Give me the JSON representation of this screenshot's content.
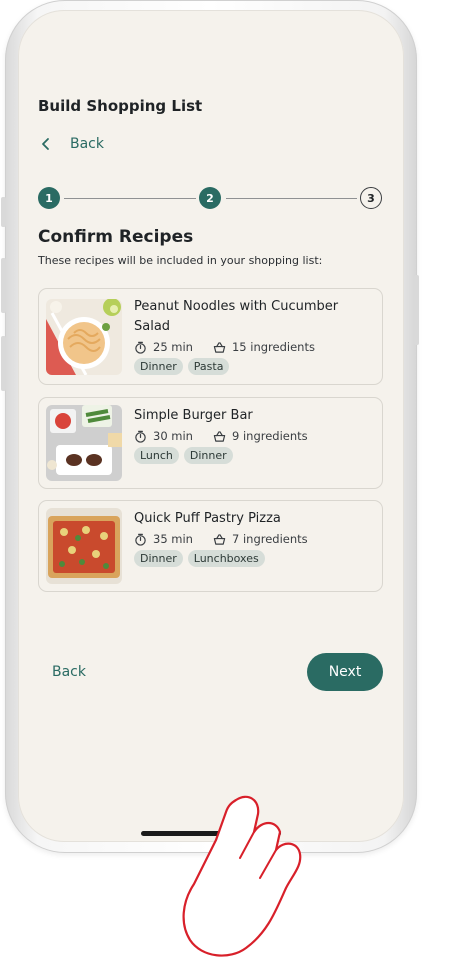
{
  "app": {
    "title": "Build Shopping List",
    "back_label": "Back"
  },
  "stepper": {
    "steps": [
      {
        "label": "1",
        "state": "done"
      },
      {
        "label": "2",
        "state": "done"
      },
      {
        "label": "3",
        "state": "todo"
      }
    ]
  },
  "section": {
    "title": "Confirm Recipes",
    "subtitle": "These recipes will be included in your shopping list:"
  },
  "recipes": [
    {
      "name": "Peanut Noodles with Cucumber Salad",
      "time": "25 min",
      "ingredients": "15 ingredients",
      "tags": [
        "Dinner",
        "Pasta"
      ]
    },
    {
      "name": "Simple Burger Bar",
      "time": "30 min",
      "ingredients": "9 ingredients",
      "tags": [
        "Lunch",
        "Dinner"
      ]
    },
    {
      "name": "Quick Puff Pastry Pizza",
      "time": "35 min",
      "ingredients": "7 ingredients",
      "tags": [
        "Dinner",
        "Lunchboxes"
      ]
    }
  ],
  "footer": {
    "back_label": "Back",
    "next_label": "Next"
  },
  "colors": {
    "accent": "#2a6b63",
    "background": "#f5f2ec",
    "tag_bg": "#d6ddd8"
  },
  "icons": {
    "back": "chevron-left-icon",
    "time": "timer-icon",
    "ingredients": "basket-icon"
  }
}
